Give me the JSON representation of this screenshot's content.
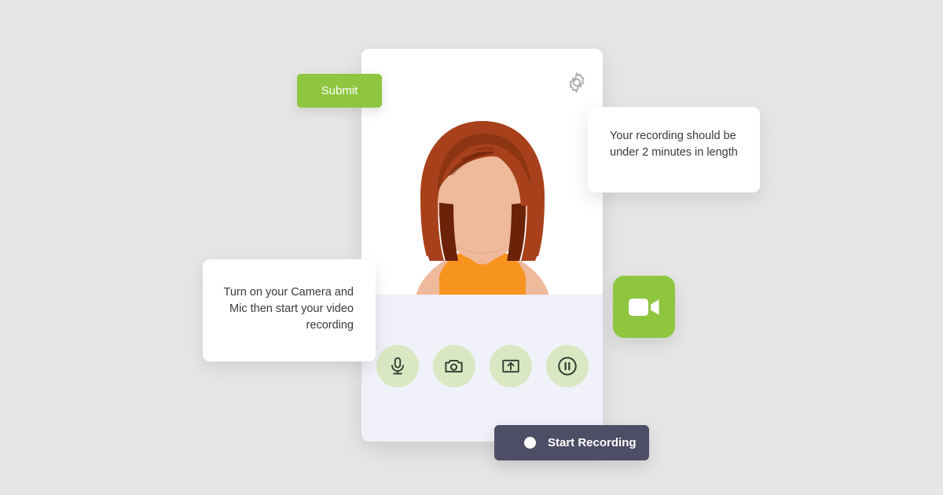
{
  "theme": {
    "background": "#e6e6e6",
    "accent_green": "#8ec63f",
    "control_circle": "#d9e8c2",
    "panel": "#f1f1fa",
    "record_button": "#4d4d66",
    "card": "#ffffff",
    "hair": "#a8411b",
    "hair_dark": "#6b2208",
    "skin": "#efb99c",
    "top": "#f7941e"
  },
  "submit": {
    "label": "Submit"
  },
  "card": {
    "settings_icon": "gear-icon",
    "avatar_alt": "avatar-illustration",
    "controls": [
      {
        "id": "microphone",
        "icon": "microphone-icon"
      },
      {
        "id": "camera",
        "icon": "camera-icon"
      },
      {
        "id": "screen-share",
        "icon": "screen-share-upload-icon"
      },
      {
        "id": "pause",
        "icon": "pause-circle-icon"
      }
    ]
  },
  "tooltips": {
    "recording_length": "Your recording should be under 2 minutes in length",
    "turn_on_devices": "Turn on your Camera and Mic then start your video recording"
  },
  "video_badge": {
    "icon": "video-camera-icon"
  },
  "record": {
    "label": "Start Recording",
    "indicator": "record-dot"
  }
}
